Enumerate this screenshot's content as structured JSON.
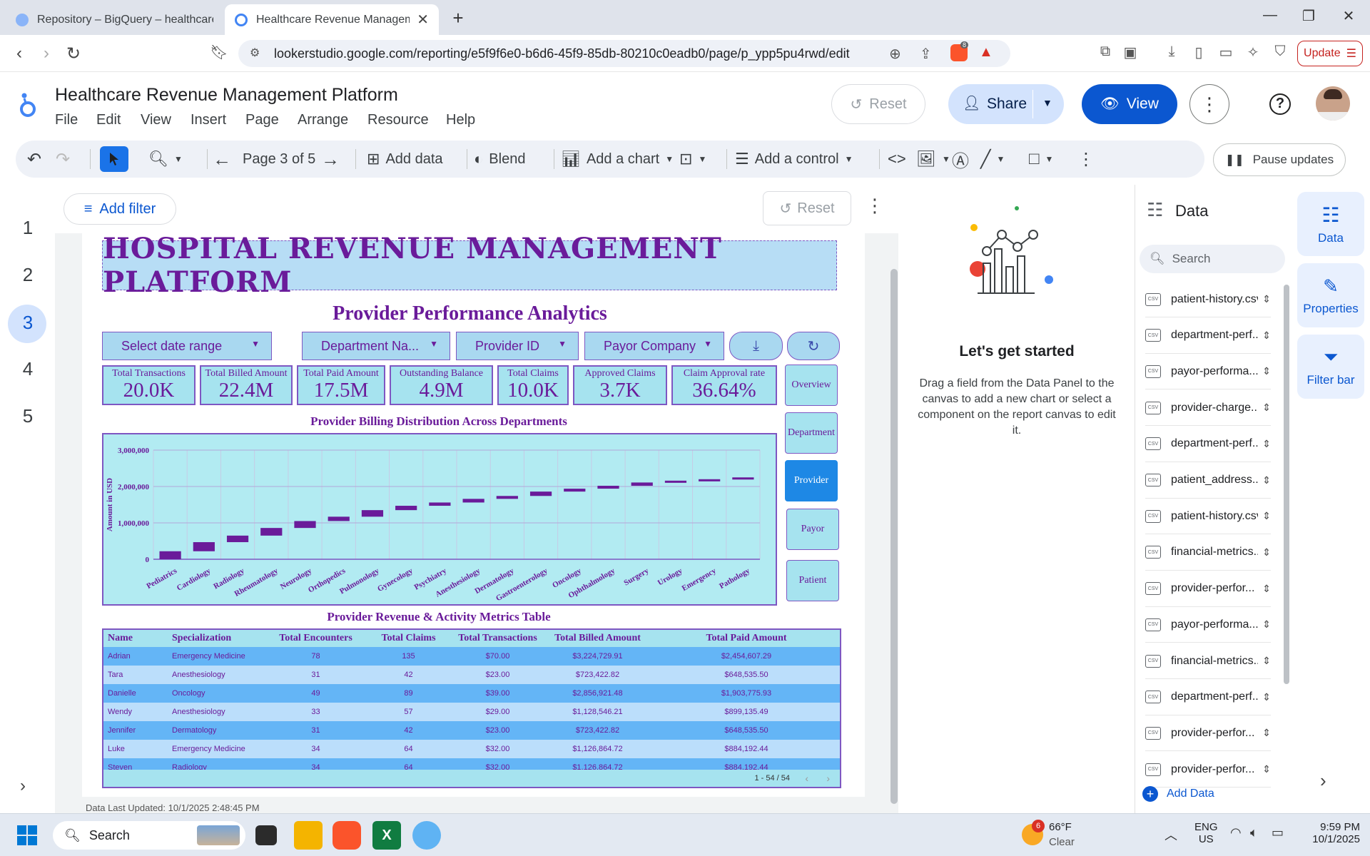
{
  "browser": {
    "tabs": [
      {
        "title": "Repository – BigQuery – healthcare d"
      },
      {
        "title": "Healthcare Revenue Managemen"
      }
    ],
    "url": "lookerstudio.google.com/reporting/e5f9f6e0-b6d6-45f9-85db-80210c0eadb0/page/p_ypp5pu4rwd/edit",
    "update_label": "Update",
    "brave_badge": "8"
  },
  "app": {
    "title": "Healthcare Revenue Management Platform",
    "menu": [
      "File",
      "Edit",
      "View",
      "Insert",
      "Page",
      "Arrange",
      "Resource",
      "Help"
    ],
    "reset_label": "Reset",
    "share_label": "Share",
    "view_label": "View"
  },
  "toolbar": {
    "page_indicator": "Page 3 of 5",
    "add_data": "Add data",
    "blend": "Blend",
    "add_chart": "Add a chart",
    "add_control": "Add a control",
    "pause_updates": "Pause updates"
  },
  "pages": [
    "1",
    "2",
    "3",
    "4",
    "5"
  ],
  "active_page": "3",
  "filterbar": {
    "add_filter": "Add filter",
    "reset": "Reset"
  },
  "report": {
    "banner": "HOSPITAL REVENUE MANAGEMENT PLATFORM",
    "subtitle": "Provider Performance Analytics",
    "controls": [
      "Select date range",
      "Department Na...",
      "Provider ID",
      "Payor Company"
    ],
    "kpis": [
      {
        "label": "Total Transactions",
        "value": "20.0K"
      },
      {
        "label": "Total Billed Amount",
        "value": "22.4M"
      },
      {
        "label": "Total Paid Amount",
        "value": "17.5M"
      },
      {
        "label": "Outstanding Balance",
        "value": "4.9M"
      },
      {
        "label": "Total Claims",
        "value": "10.0K"
      },
      {
        "label": "Approved Claims",
        "value": "3.7K"
      },
      {
        "label": "Claim Approval rate",
        "value": "36.64%"
      }
    ],
    "nav_buttons": [
      "Overview",
      "Department",
      "Provider",
      "Payor",
      "Patient"
    ],
    "active_nav": "Provider",
    "chart_title": "Provider Billing Distribution Across Departments",
    "table_title": "Provider Revenue & Activity Metrics Table",
    "table": {
      "columns": [
        "Name",
        "Specialization",
        "Total Encounters",
        "Total Claims",
        "Total Transactions",
        "Total Billed Amount",
        "Total Paid Amount"
      ],
      "rows": [
        [
          "Adrian",
          "Emergency Medicine",
          "78",
          "135",
          "$70.00",
          "$3,224,729.91",
          "$2,454,607.29"
        ],
        [
          "Tara",
          "Anesthesiology",
          "31",
          "42",
          "$23.00",
          "$723,422.82",
          "$648,535.50"
        ],
        [
          "Danielle",
          "Oncology",
          "49",
          "89",
          "$39.00",
          "$2,856,921.48",
          "$1,903,775.93"
        ],
        [
          "Wendy",
          "Anesthesiology",
          "33",
          "57",
          "$29.00",
          "$1,128,546.21",
          "$899,135.49"
        ],
        [
          "Jennifer",
          "Dermatology",
          "31",
          "42",
          "$23.00",
          "$723,422.82",
          "$648,535.50"
        ],
        [
          "Luke",
          "Emergency Medicine",
          "34",
          "64",
          "$32.00",
          "$1,126,864.72",
          "$884,192.44"
        ],
        [
          "Steven",
          "Radiology",
          "34",
          "64",
          "$32.00",
          "$1,126,864.72",
          "$884,192.44"
        ]
      ],
      "pagination": "1 - 54 / 54"
    },
    "last_updated": "Data Last Updated: 10/1/2025 2:48:45 PM"
  },
  "chart_data": {
    "type": "bar",
    "title": "Provider Billing Distribution Across Departments",
    "ylabel": "Amount in USD",
    "ylim": [
      0,
      3000000
    ],
    "yticks": [
      "0",
      "1,000,000",
      "2,000,000",
      "3,000,000"
    ],
    "ytick_values": [
      0,
      1000000,
      2000000,
      3000000
    ],
    "categories": [
      "Pediatrics",
      "Cardiology",
      "Radiology",
      "Rheumatology",
      "Neurology",
      "Orthopedics",
      "Pulmonology",
      "Gynecology",
      "Psychiatry",
      "Anesthesiology",
      "Dermatology",
      "Gastroenterology",
      "Oncology",
      "Ophthalmology",
      "Surgery",
      "Urology",
      "Emergency",
      "Pathology"
    ],
    "low": [
      0,
      220000,
      470000,
      650000,
      860000,
      1050000,
      1170000,
      1350000,
      1470000,
      1560000,
      1660000,
      1740000,
      1860000,
      1940000,
      2020000,
      2110000,
      2160000,
      2200000
    ],
    "high": [
      220000,
      470000,
      650000,
      860000,
      1050000,
      1170000,
      1350000,
      1470000,
      1560000,
      1660000,
      1740000,
      1860000,
      1940000,
      2020000,
      2110000,
      2160000,
      2200000,
      2250000
    ],
    "color": "#6a1b9a",
    "grid": true
  },
  "middle_panel": {
    "heading": "Let's get started",
    "description": "Drag a field from the Data Panel to the canvas to add a new chart or select a component on the report canvas to edit it."
  },
  "data_panel": {
    "title": "Data",
    "search_placeholder": "Search",
    "sources": [
      "patient-history.csv",
      "department-perf...",
      "payor-performa...",
      "provider-charge...",
      "department-perf...",
      "patient_address....",
      "patient-history.csv",
      "financial-metrics....",
      "provider-perfor...",
      "payor-performa...",
      "financial-metrics....",
      "department-perf...",
      "provider-perfor...",
      "provider-perfor..."
    ],
    "add_data": "Add Data"
  },
  "right_rail": {
    "data": "Data",
    "properties": "Properties",
    "filter_bar": "Filter bar"
  },
  "taskbar": {
    "search": "Search",
    "weather_temp": "66°F",
    "weather_cond": "Clear",
    "weather_badge": "6",
    "lang": "ENG",
    "region": "US",
    "time": "9:59 PM",
    "date": "10/1/2025"
  },
  "colors": {
    "accent": "#0b57d0",
    "report_purple": "#6a1b9a",
    "report_cyan": "#b2ebf2"
  }
}
